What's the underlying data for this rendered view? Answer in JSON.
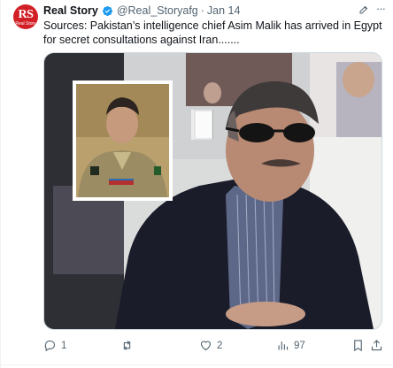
{
  "tweet": {
    "avatar_text": "RS",
    "avatar_subtext": "Real Story",
    "display_name": "Real Story",
    "handle": "@Real_Storyafg",
    "separator": "·",
    "date": "Jan 14",
    "text": "Sources: Pakistan’s intelligence chief Asim Malik has arrived in Egypt for secret consultations against Iran.......",
    "media": {
      "description_icon": "photo"
    },
    "actions": {
      "reply_count": "1",
      "retweet_count": "",
      "like_count": "2",
      "view_count": "97"
    }
  },
  "colors": {
    "brand_red": "#d21f26",
    "verified_blue": "#1d9bf0",
    "text_primary": "#0f1419",
    "text_secondary": "#536471"
  },
  "icons": [
    "verified-badge-icon",
    "edit-icon",
    "more-icon",
    "reply-icon",
    "retweet-icon",
    "like-icon",
    "views-icon",
    "bookmark-icon",
    "share-icon"
  ]
}
